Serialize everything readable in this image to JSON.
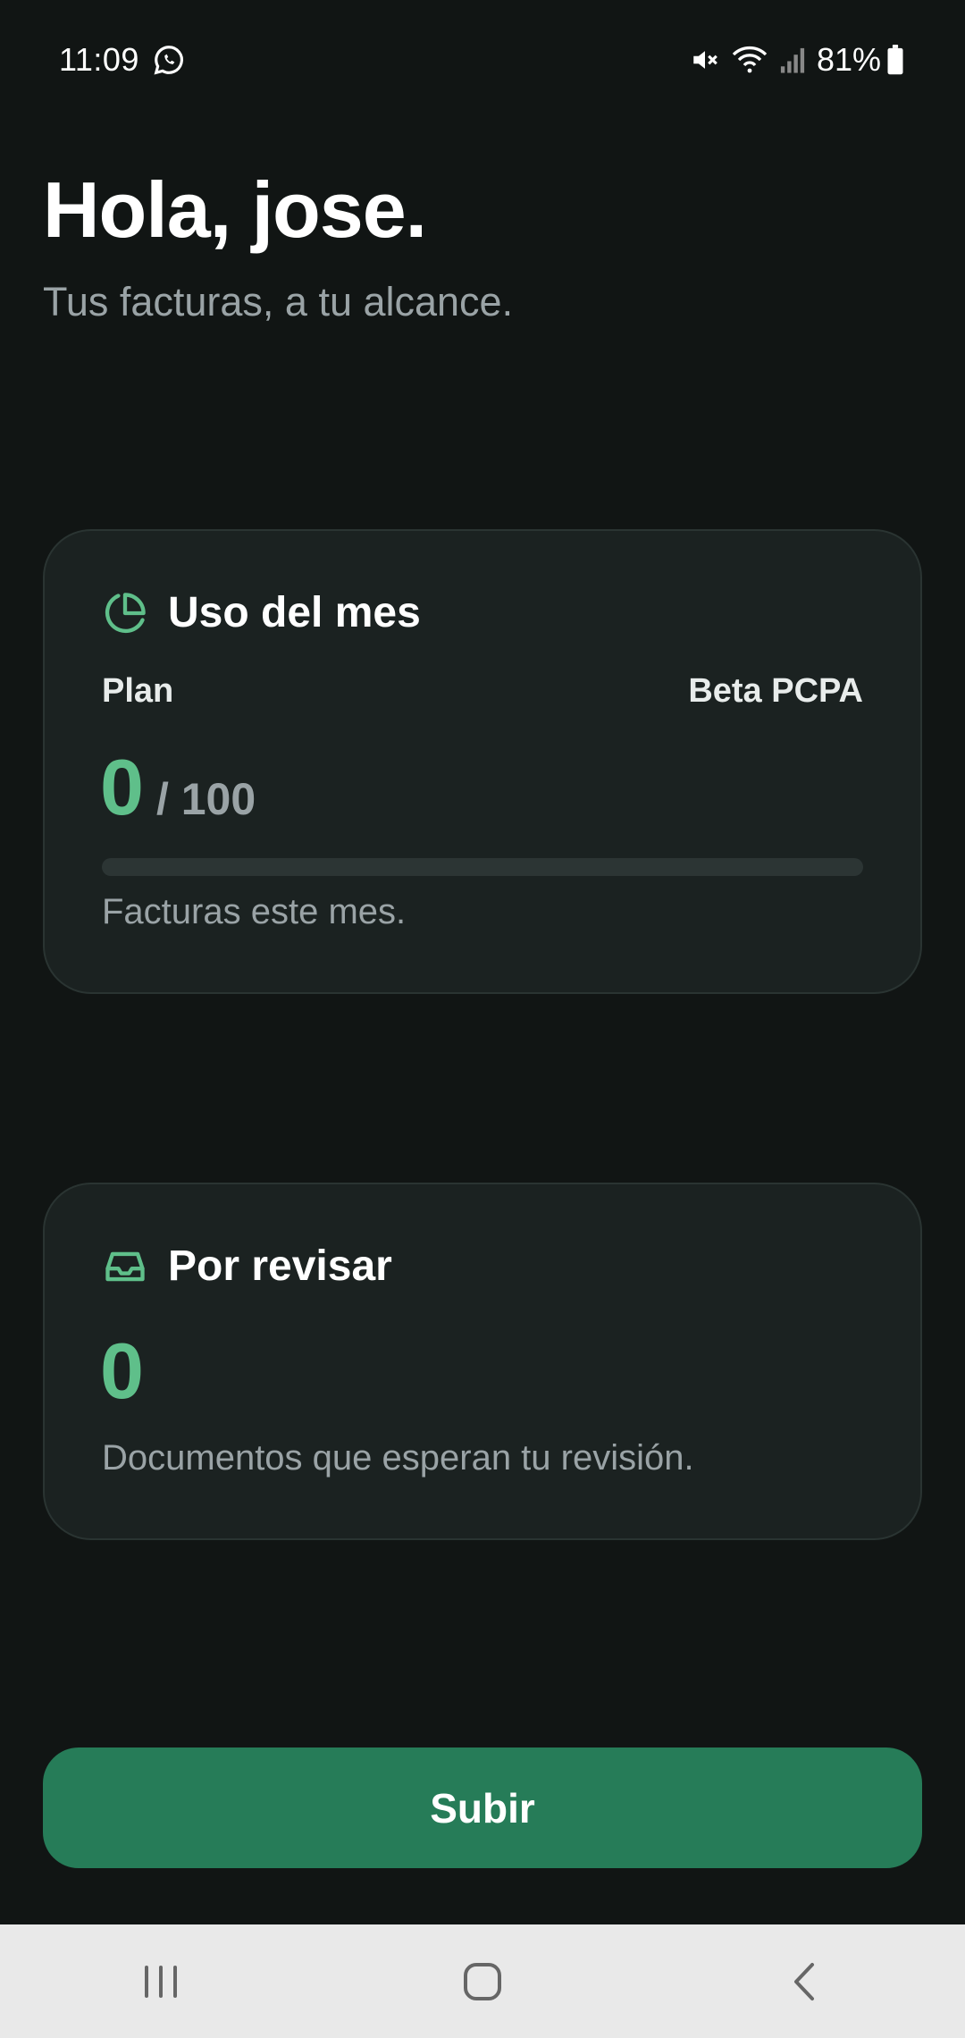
{
  "status_bar": {
    "time": "11:09",
    "battery": "81%"
  },
  "header": {
    "greeting": "Hola, jose.",
    "subtitle": "Tus facturas, a tu alcance."
  },
  "usage_card": {
    "title": "Uso del mes",
    "icon": "pie-chart-icon",
    "plan_label": "Plan",
    "plan_value": "Beta PCPA",
    "used": "0",
    "limit": "/ 100",
    "progress_fraction": 0,
    "caption": "Facturas este mes."
  },
  "review_card": {
    "title": "Por revisar",
    "icon": "inbox-icon",
    "count": "0",
    "caption": "Documentos que esperan tu revisión."
  },
  "actions": {
    "upload_label": "Subir"
  },
  "colors": {
    "background": "#111514",
    "card": "#1b2221",
    "accent": "#5fbf8a",
    "button": "#267c58",
    "muted_text": "#9aa3a6"
  }
}
